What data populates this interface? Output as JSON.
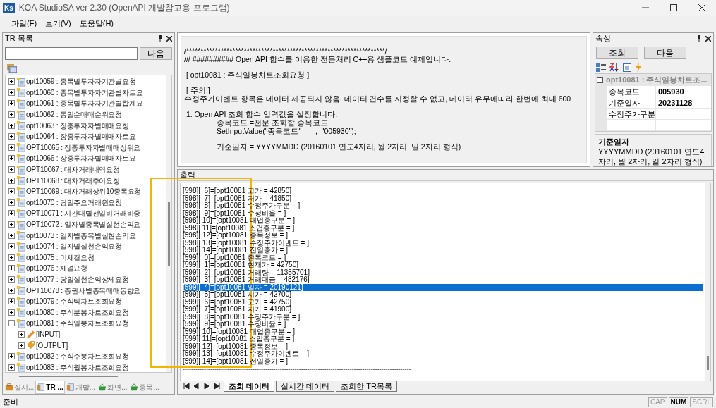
{
  "window": {
    "logo": "Ks",
    "title": "KOA StudioSA ver 2.30  (OpenAPI 개발참고용 프로그램)"
  },
  "menu": [
    "파일(F)",
    "보기(V)",
    "도움말(H)"
  ],
  "tr_panel": {
    "title": "TR 목록",
    "search_button": "다음",
    "items": [
      {
        "label": "opt10059 : 종목별투자자기관별요청",
        "expanded": false
      },
      {
        "label": "opt10060 : 종목별투자자기관별차트요",
        "expanded": false
      },
      {
        "label": "opt10061 : 종목별투자자기관별합계요",
        "expanded": false
      },
      {
        "label": "opt10062 : 동일순매매순위요청",
        "expanded": false
      },
      {
        "label": "opt10063 : 장중투자자별매매요청",
        "expanded": false
      },
      {
        "label": "opt10064 : 장중투자자별매매차트요",
        "expanded": false
      },
      {
        "label": "OPT10065 : 장중투자자별매매상위요",
        "expanded": false
      },
      {
        "label": "opt10066 : 장중투자자별매매차트요",
        "expanded": false
      },
      {
        "label": "OPT10067 : 대차거래내역요청",
        "expanded": false
      },
      {
        "label": "OPT10068 : 대차거래추이요청",
        "expanded": false
      },
      {
        "label": "OPT10069 : 대차거래상위10종목요청",
        "expanded": false
      },
      {
        "label": "opt10070 : 당일주요거래원요청",
        "expanded": false
      },
      {
        "label": "OPT10071 : 시간대별전일비거래비중",
        "expanded": false
      },
      {
        "label": "OPT10072 : 일자별종목별실현손익요",
        "expanded": false
      },
      {
        "label": "opt10073 : 일자별종목별실현손익요",
        "expanded": false
      },
      {
        "label": "opt10074 : 일자별실현손익요청",
        "expanded": false
      },
      {
        "label": "opt10075 : 미체결요청",
        "expanded": false
      },
      {
        "label": "opt10076 : 체결요청",
        "expanded": false
      },
      {
        "label": "opt10077 : 당일실현손익상세요청",
        "expanded": false
      },
      {
        "label": "OPT10078 : 증권사별종목매매동향요",
        "expanded": false
      },
      {
        "label": "opt10079 : 주식틱차트조회요청",
        "expanded": false
      },
      {
        "label": "opt10080 : 주식분봉차트조회요청",
        "expanded": false
      },
      {
        "label": "opt10081 : 주식일봉차트조회요청",
        "expanded": true,
        "children": [
          {
            "label": "[INPUT]",
            "kind": "input",
            "expanded": false
          },
          {
            "label": "[OUTPUT]",
            "kind": "output",
            "expanded": false
          }
        ]
      },
      {
        "label": "opt10082 : 주식주봉차트조회요청",
        "expanded": false
      },
      {
        "label": "opt10083 : 주식월봉차트조회요청",
        "expanded": false
      }
    ],
    "tabs": [
      {
        "label": "실시...",
        "kind": "briefcase",
        "selected": false
      },
      {
        "label": "TR ...",
        "kind": "document",
        "selected": true
      },
      {
        "label": "개발...",
        "kind": "document",
        "selected": false
      },
      {
        "label": "화면...",
        "kind": "basket",
        "selected": false
      },
      {
        "label": "종목...",
        "kind": "basket",
        "selected": false
      }
    ]
  },
  "code_view": {
    "blocks": [
      {
        "lines": [
          {
            "text": "/*********************************************************************/",
            "kind": "plain"
          },
          {
            "text": "/// ########## Open API 함수를 이용한 전문처리 C++용 샘플코드 예제입니다.",
            "kind": "plain"
          }
        ]
      },
      {
        "lines": [
          {
            "text": " [ opt10081 : 주식일봉차트조회요청 ]",
            "kind": "plain"
          }
        ]
      },
      {
        "lines": [
          {
            "text": " [ 주의 ]",
            "kind": "plain"
          },
          {
            "text": "수정주가이벤트 항목은 데이터 제공되지 않음. 데이터 건수를 지정할 수 없고, 데이터 유무에따라 한번에 최대 600",
            "kind": "plain"
          }
        ]
      },
      {
        "lines": [
          {
            "text": " 1. Open API 조회 함수 입력값을 설정합니다.",
            "kind": "plain"
          },
          {
            "text": "종목코드 =전문 조회할 종목코드",
            "kind": "indented"
          },
          {
            "text": "SetInputValue(\"종목코드\"\t,  \"005930\");",
            "kind": "indented"
          }
        ]
      },
      {
        "lines": [
          {
            "text": "기준일자 = YYYYMMDD (20160101 연도4자리, 월 2자리, 일 2자리 형식)",
            "kind": "indented"
          }
        ]
      }
    ]
  },
  "properties": {
    "title": "속성",
    "buttons": [
      "조회",
      "다음"
    ],
    "category": "opt10081 : 주식일봉차트조...",
    "rows": [
      {
        "name": "종목코드",
        "value": "005930"
      },
      {
        "name": "기준일자",
        "value": "20231128"
      },
      {
        "name": "수정주가구분"
      }
    ],
    "help_title": "기준일자",
    "help_text": "YYYYMMDD (20160101 연도4자리, 월 2자리, 일 2자리 형식)"
  },
  "output": {
    "title": "출력",
    "lines": [
      {
        "text": "[598][  6]=[opt10081 고가 = 42850]",
        "selected": false
      },
      {
        "text": "[598][  7]=[opt10081 저가 = 41850]",
        "selected": false
      },
      {
        "text": "[598][  8]=[opt10081 수정주가구분 = ]",
        "selected": false
      },
      {
        "text": "[598][  9]=[opt10081 수정비율 = ]",
        "selected": false
      },
      {
        "text": "[598][ 10]=[opt10081 대업종구분 = ]",
        "selected": false
      },
      {
        "text": "[598][ 11]=[opt10081 소업종구분 = ]",
        "selected": false
      },
      {
        "text": "[598][ 12]=[opt10081 종목정보 = ]",
        "selected": false
      },
      {
        "text": "[598][ 13]=[opt10081 수정주가이벤트 = ]",
        "selected": false
      },
      {
        "text": "[598][ 14]=[opt10081 전일종가 = ]",
        "selected": false
      },
      {
        "text": "[599][  0]=[opt10081 종목코드 = ]",
        "selected": false
      },
      {
        "text": "[599][  1]=[opt10081 현재가 = 42750]",
        "selected": false
      },
      {
        "text": "[599][  2]=[opt10081 거래량 = 11355701]",
        "selected": false
      },
      {
        "text": "[599][  3]=[opt10081 거래대금 = 482176]",
        "selected": false
      },
      {
        "text": "[599][  4]=[opt10081 일자 = 20190121]",
        "selected": true
      },
      {
        "text": "[599][  5]=[opt10081 시가 = 42700]",
        "selected": false
      },
      {
        "text": "[599][  6]=[opt10081 고가 = 42750]",
        "selected": false
      },
      {
        "text": "[599][  7]=[opt10081 저가 = 41900]",
        "selected": false
      },
      {
        "text": "[599][  8]=[opt10081 수정주가구분 = ]",
        "selected": false
      },
      {
        "text": "[599][  9]=[opt10081 수정비율 = ]",
        "selected": false
      },
      {
        "text": "[599][ 10]=[opt10081 대업종구분 = ]",
        "selected": false
      },
      {
        "text": "[599][ 11]=[opt10081 소업종구분 = ]",
        "selected": false
      },
      {
        "text": "[599][ 12]=[opt10081 종목정보 = ]",
        "selected": false
      },
      {
        "text": "[599][ 13]=[opt10081 수정주가이벤트 = ]",
        "selected": false
      },
      {
        "text": "[599][ 14]=[opt10081 전일종가 = ]",
        "selected": false
      }
    ],
    "separator": "------------------------------------------------------------------------------------------------------------",
    "tabs": [
      {
        "label": "조회 데이터",
        "selected": true
      },
      {
        "label": "실시간 데이터",
        "selected": false
      },
      {
        "label": "조회한 TR목록",
        "selected": false
      }
    ]
  },
  "status_bar": {
    "text": "준비",
    "indicators": [
      {
        "label": "CAP",
        "on": false
      },
      {
        "label": "NUM",
        "on": true
      },
      {
        "label": "SCRL",
        "on": false
      }
    ]
  }
}
